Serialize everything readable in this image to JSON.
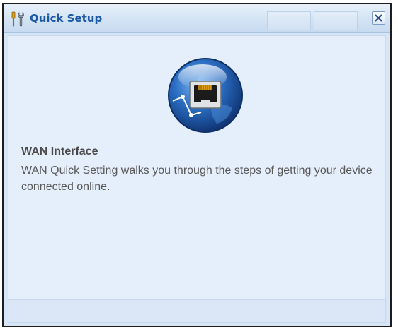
{
  "window": {
    "title": "Quick Setup",
    "title_icon": "tools-icon",
    "close_icon": "close-icon"
  },
  "content": {
    "illustration_icon": "ethernet-globe-icon",
    "heading": "WAN Interface",
    "description": "WAN Quick Setting walks you through the steps of getting your device connected online."
  },
  "colors": {
    "title_text": "#1c5aa6",
    "panel_bg": "#e5eefb",
    "globe_blue": "#1f5fb5"
  }
}
